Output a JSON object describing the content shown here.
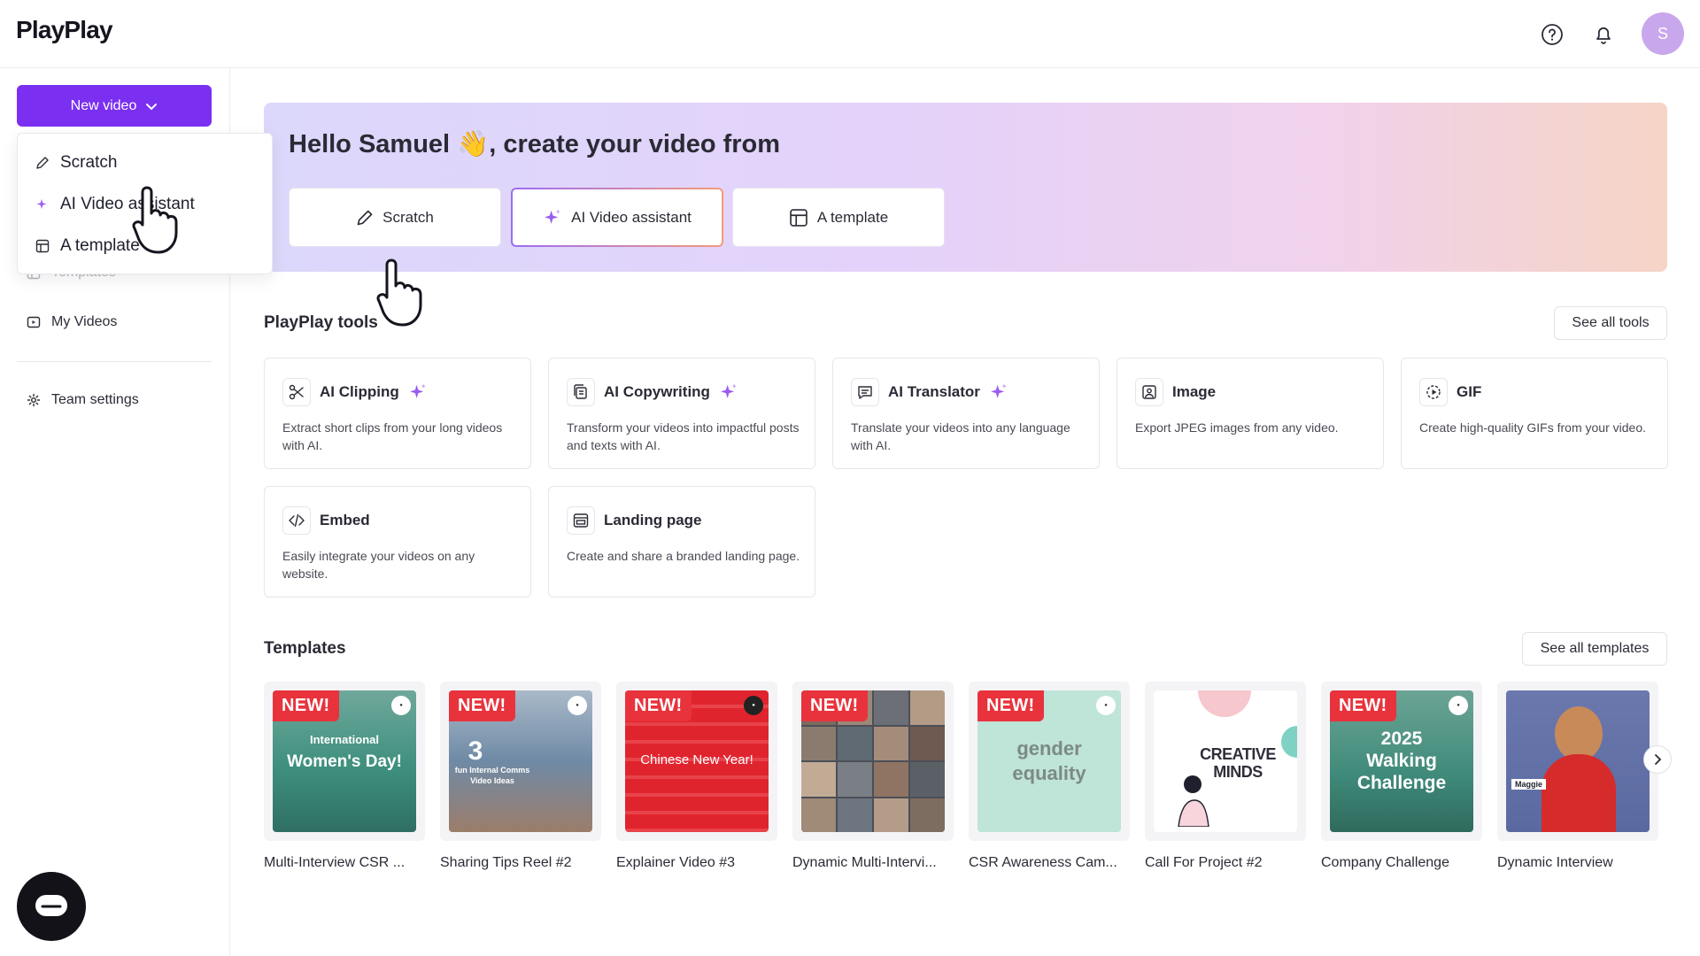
{
  "app": {
    "logo": "PlayPlay",
    "avatar_initial": "S"
  },
  "sidebar": {
    "new_video_label": "New video",
    "dropdown_items": [
      "Scratch",
      "AI Video assistant",
      "A template"
    ],
    "items": [
      {
        "label": "Templates"
      },
      {
        "label": "My Videos"
      },
      {
        "label": "Team settings"
      }
    ]
  },
  "hero": {
    "title": "Hello Samuel 👋, create your video from",
    "buttons": [
      "Scratch",
      "AI Video assistant",
      "A template"
    ]
  },
  "tools": {
    "title": "PlayPlay tools",
    "see_all": "See all tools",
    "items": [
      {
        "name": "AI Clipping",
        "desc": "Extract short clips from your long videos with AI.",
        "icon": "scissors-icon",
        "ai": true
      },
      {
        "name": "AI Copywriting",
        "desc": "Transform your videos into impactful posts and texts with AI.",
        "icon": "copy-text-icon",
        "ai": true
      },
      {
        "name": "AI Translator",
        "desc": "Translate your videos into any language with AI.",
        "icon": "chat-translate-icon",
        "ai": true
      },
      {
        "name": "Image",
        "desc": "Export JPEG images from any video.",
        "icon": "image-icon",
        "ai": false
      },
      {
        "name": "GIF",
        "desc": "Create high-quality GIFs from your video.",
        "icon": "gif-play-icon",
        "ai": false
      },
      {
        "name": "Embed",
        "desc": "Easily integrate your videos on any website.",
        "icon": "code-icon",
        "ai": false
      },
      {
        "name": "Landing page",
        "desc": "Create and share a branded landing page.",
        "icon": "landing-page-icon",
        "ai": false
      }
    ]
  },
  "templates": {
    "title": "Templates",
    "see_all": "See all templates",
    "badge": "NEW!",
    "items": [
      {
        "name": "Multi-Interview CSR ...",
        "thumb_text": "Women's Day!",
        "thumb_sub": "International",
        "color": "#3e8f7e"
      },
      {
        "name": "Sharing Tips Reel #2",
        "thumb_text": "3",
        "thumb_sub": "fun Internal Comms Video Ideas",
        "color": "#6f8aa6"
      },
      {
        "name": "Explainer Video #3",
        "thumb_text": "Chinese New Year!",
        "thumb_sub": "",
        "color": "#e0242e"
      },
      {
        "name": "Dynamic Multi-Intervi...",
        "thumb_text": "",
        "thumb_sub": "",
        "color": "#4b4f58"
      },
      {
        "name": "CSR Awareness Cam...",
        "thumb_text": "gender equality",
        "thumb_sub": "",
        "color": "#bfe4d8"
      },
      {
        "name": "Call For Project #2",
        "thumb_text": "CREATIVE MINDS",
        "thumb_sub": "",
        "color": "#ffffff"
      },
      {
        "name": "Company Challenge",
        "thumb_text": "2025 Walking Challenge",
        "thumb_sub": "",
        "color": "#3f8a7a"
      },
      {
        "name": "Dynamic Interview",
        "thumb_text": "Maggie",
        "thumb_sub": "",
        "color": "#5a6aa0"
      }
    ]
  },
  "colors": {
    "brand": "#7b2ff0",
    "badge": "#e8333d"
  }
}
